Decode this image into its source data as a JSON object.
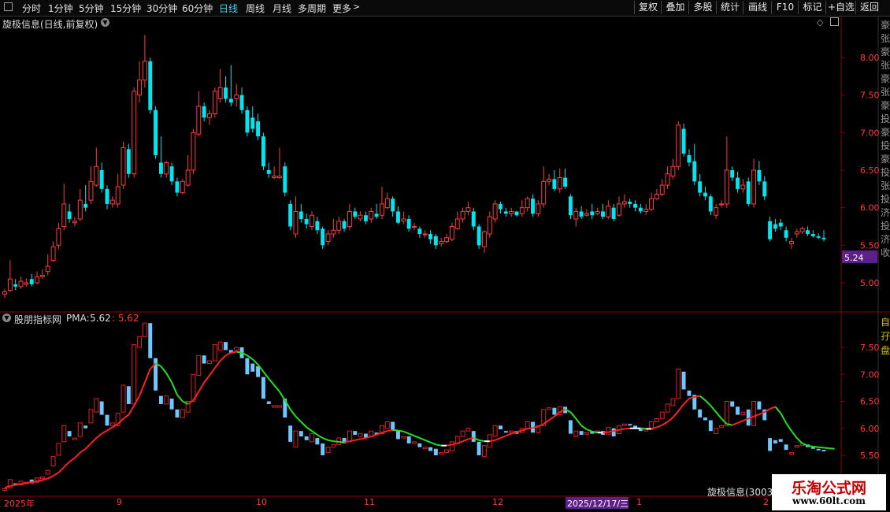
{
  "toolbar": {
    "items": [
      "分时",
      "1分钟",
      "5分钟",
      "15分钟",
      "30分钟",
      "60分钟",
      "日线",
      "周线",
      "月线",
      "多周期",
      "更多"
    ],
    "active": "日线",
    "right_buttons": [
      "复权",
      "叠加",
      "多股",
      "统计",
      "画线",
      "F10",
      "标记",
      "+自选",
      "返回"
    ]
  },
  "main_panel": {
    "title": "旋极信息(日线,前复权)",
    "price_axis": [
      "8.00",
      "7.50",
      "7.00",
      "6.50",
      "6.00",
      "5.50",
      "5.00"
    ],
    "current_price": "5.24",
    "right_strip_chars": "豪张豪张豪张豪投豪投豪投张投济投济收"
  },
  "indicator_panel": {
    "name": "股朋指标网",
    "pma_label": "PMA:",
    "pma_value": "5.62",
    "pma_value2": ": 5.62",
    "axis": [
      "7.50",
      "7.00",
      "6.50",
      "6.00",
      "5.50"
    ],
    "right_strip_chars": "自 孖 盘"
  },
  "time_axis": {
    "labels": [
      "2025年",
      "9",
      "10",
      "11",
      "12",
      "2025/12/17/三",
      "1",
      "2"
    ],
    "bottom_stock": "旋极信息(3003"
  },
  "watermark": {
    "title": "乐淘公式网",
    "url": "www.60lt.com"
  },
  "colors": {
    "up": "#ff3c3c",
    "down": "#00e5ee",
    "grid": "#7a0000",
    "accent": "#35d6f0",
    "highlight": "#5c1f8c",
    "ma_up": "#ff2020",
    "ma_down": "#22e022"
  },
  "chart_data": {
    "type": "candlestick",
    "symbol": "旋极信息",
    "ylim": [
      4.75,
      8.3
    ],
    "indicator_ylim": [
      5.35,
      7.95
    ],
    "candles": [
      [
        4.85,
        4.88,
        4.8,
        4.92
      ],
      [
        4.9,
        5.05,
        4.88,
        5.3
      ],
      [
        4.98,
        4.95,
        4.9,
        5.05
      ],
      [
        4.95,
        5.02,
        4.92,
        5.08
      ],
      [
        4.98,
        5.0,
        4.95,
        5.06
      ],
      [
        5.05,
        4.98,
        4.95,
        5.12
      ],
      [
        5.0,
        5.08,
        4.98,
        5.15
      ],
      [
        5.08,
        5.1,
        5.05,
        5.18
      ],
      [
        5.15,
        5.22,
        5.1,
        5.38
      ],
      [
        5.3,
        5.48,
        5.28,
        5.55
      ],
      [
        5.5,
        5.72,
        5.45,
        5.8
      ],
      [
        5.75,
        6.05,
        5.7,
        6.32
      ],
      [
        5.95,
        5.85,
        5.8,
        6.05
      ],
      [
        5.8,
        5.82,
        5.75,
        5.88
      ],
      [
        5.85,
        6.1,
        5.82,
        6.25
      ],
      [
        6.05,
        6.0,
        5.95,
        6.3
      ],
      [
        6.1,
        6.35,
        6.05,
        6.55
      ],
      [
        6.3,
        6.55,
        6.28,
        6.8
      ],
      [
        6.5,
        6.25,
        6.2,
        6.6
      ],
      [
        6.25,
        6.05,
        5.98,
        6.3
      ],
      [
        6.05,
        6.1,
        6.0,
        6.15
      ],
      [
        6.05,
        6.28,
        6.0,
        6.45
      ],
      [
        6.3,
        6.8,
        6.25,
        6.88
      ],
      [
        6.78,
        6.45,
        6.4,
        6.85
      ],
      [
        6.45,
        7.55,
        6.4,
        7.6
      ],
      [
        7.5,
        7.7,
        7.4,
        7.95
      ],
      [
        7.7,
        7.95,
        7.6,
        8.3
      ],
      [
        7.95,
        7.3,
        7.25,
        8.0
      ],
      [
        7.3,
        6.7,
        6.65,
        7.35
      ],
      [
        6.6,
        6.45,
        6.4,
        6.95
      ],
      [
        6.45,
        6.6,
        6.4,
        6.62
      ],
      [
        6.55,
        6.35,
        6.3,
        6.6
      ],
      [
        6.35,
        6.2,
        6.15,
        6.4
      ],
      [
        6.2,
        6.35,
        6.18,
        6.38
      ],
      [
        6.3,
        6.5,
        6.28,
        6.7
      ],
      [
        6.5,
        7.0,
        6.45,
        7.05
      ],
      [
        6.98,
        7.35,
        6.95,
        7.55
      ],
      [
        7.35,
        7.2,
        7.15,
        7.4
      ],
      [
        7.2,
        7.25,
        7.1,
        7.3
      ],
      [
        7.25,
        7.55,
        7.2,
        7.6
      ],
      [
        7.45,
        7.6,
        7.4,
        7.85
      ],
      [
        7.6,
        7.45,
        7.4,
        7.75
      ],
      [
        7.45,
        7.4,
        7.35,
        7.9
      ],
      [
        7.45,
        7.5,
        7.35,
        7.65
      ],
      [
        7.5,
        7.3,
        7.25,
        7.6
      ],
      [
        7.3,
        7.0,
        6.95,
        7.35
      ],
      [
        7.2,
        7.05,
        7.0,
        7.35
      ],
      [
        7.15,
        6.95,
        6.9,
        7.25
      ],
      [
        6.95,
        6.55,
        6.5,
        7.0
      ],
      [
        6.5,
        6.45,
        6.4,
        6.6
      ],
      [
        6.4,
        6.42,
        6.38,
        6.55
      ],
      [
        6.4,
        6.42,
        6.38,
        6.8
      ],
      [
        6.55,
        6.2,
        6.15,
        6.6
      ],
      [
        6.05,
        5.75,
        5.7,
        6.1
      ],
      [
        5.65,
        5.95,
        5.6,
        6.15
      ],
      [
        5.95,
        5.85,
        5.8,
        6.05
      ],
      [
        5.85,
        5.78,
        5.72,
        5.92
      ],
      [
        5.75,
        5.9,
        5.7,
        5.95
      ],
      [
        5.82,
        5.7,
        5.65,
        5.88
      ],
      [
        5.72,
        5.5,
        5.45,
        5.75
      ],
      [
        5.55,
        5.65,
        5.5,
        5.7
      ],
      [
        5.65,
        5.7,
        5.6,
        5.85
      ],
      [
        5.7,
        5.82,
        5.65,
        5.88
      ],
      [
        5.82,
        5.72,
        5.68,
        5.85
      ],
      [
        5.75,
        5.95,
        5.7,
        6.05
      ],
      [
        5.95,
        5.88,
        5.85,
        6.0
      ],
      [
        5.85,
        5.9,
        5.82,
        5.95
      ],
      [
        5.9,
        5.82,
        5.78,
        5.95
      ],
      [
        5.85,
        5.95,
        5.8,
        6.0
      ],
      [
        5.92,
        5.88,
        5.85,
        6.05
      ],
      [
        5.9,
        6.05,
        5.85,
        6.28
      ],
      [
        6.0,
        6.12,
        5.98,
        6.2
      ],
      [
        6.12,
        5.95,
        5.88,
        6.15
      ],
      [
        5.95,
        5.8,
        5.78,
        6.02
      ],
      [
        5.82,
        5.85,
        5.78,
        5.95
      ],
      [
        5.85,
        5.72,
        5.68,
        5.9
      ],
      [
        5.75,
        5.75,
        5.7,
        5.8
      ],
      [
        5.72,
        5.65,
        5.6,
        5.75
      ],
      [
        5.65,
        5.65,
        5.6,
        5.7
      ],
      [
        5.65,
        5.58,
        5.52,
        5.7
      ],
      [
        5.62,
        5.5,
        5.45,
        5.65
      ],
      [
        5.52,
        5.55,
        5.48,
        5.6
      ],
      [
        5.55,
        5.6,
        5.52,
        5.65
      ],
      [
        5.58,
        5.75,
        5.55,
        5.8
      ],
      [
        5.72,
        5.85,
        5.7,
        5.95
      ],
      [
        5.85,
        5.95,
        5.8,
        6.0
      ],
      [
        5.95,
        6.0,
        5.9,
        6.08
      ],
      [
        5.95,
        5.75,
        5.7,
        6.0
      ],
      [
        5.75,
        5.5,
        5.45,
        5.78
      ],
      [
        5.48,
        5.68,
        5.4,
        5.7
      ],
      [
        5.65,
        5.88,
        5.6,
        5.95
      ],
      [
        5.85,
        6.05,
        5.8,
        6.1
      ],
      [
        6.05,
        5.98,
        5.92,
        6.08
      ],
      [
        5.95,
        5.92,
        5.88,
        6.0
      ],
      [
        5.92,
        5.95,
        5.88,
        6.0
      ],
      [
        5.95,
        5.9,
        5.88,
        5.95
      ],
      [
        5.92,
        6.0,
        5.88,
        6.1
      ],
      [
        6.0,
        6.12,
        5.95,
        6.15
      ],
      [
        6.12,
        5.92,
        5.88,
        6.18
      ],
      [
        5.92,
        6.05,
        5.88,
        6.1
      ],
      [
        6.05,
        6.35,
        6.0,
        6.55
      ],
      [
        6.35,
        6.38,
        6.3,
        6.45
      ],
      [
        6.38,
        6.25,
        6.22,
        6.5
      ],
      [
        6.25,
        6.4,
        6.2,
        6.52
      ],
      [
        6.4,
        6.28,
        6.25,
        6.52
      ],
      [
        6.15,
        5.9,
        5.85,
        6.18
      ],
      [
        5.85,
        5.95,
        5.75,
        6.0
      ],
      [
        5.95,
        5.88,
        5.85,
        6.02
      ],
      [
        5.9,
        5.92,
        5.88,
        5.98
      ],
      [
        5.95,
        5.9,
        5.85,
        6.05
      ],
      [
        5.92,
        5.95,
        5.9,
        6.0
      ],
      [
        5.95,
        5.88,
        5.85,
        6.05
      ],
      [
        5.88,
        6.02,
        5.85,
        6.1
      ],
      [
        6.0,
        5.85,
        5.82,
        6.05
      ],
      [
        5.9,
        6.05,
        5.88,
        6.15
      ],
      [
        6.05,
        6.08,
        6.0,
        6.18
      ],
      [
        6.08,
        6.05,
        6.0,
        6.12
      ],
      [
        6.05,
        6.0,
        5.95,
        6.1
      ],
      [
        6.0,
        5.95,
        5.92,
        6.05
      ],
      [
        5.95,
        5.98,
        5.9,
        6.05
      ],
      [
        5.98,
        6.12,
        5.95,
        6.2
      ],
      [
        6.12,
        6.18,
        6.1,
        6.25
      ],
      [
        6.18,
        6.3,
        6.15,
        6.38
      ],
      [
        6.3,
        6.45,
        6.25,
        6.55
      ],
      [
        6.42,
        6.55,
        6.38,
        6.65
      ],
      [
        6.55,
        7.1,
        6.5,
        7.15
      ],
      [
        7.05,
        6.72,
        6.68,
        7.12
      ],
      [
        6.7,
        6.6,
        6.55,
        6.78
      ],
      [
        6.62,
        6.35,
        6.3,
        6.85
      ],
      [
        6.35,
        6.2,
        6.15,
        6.45
      ],
      [
        6.2,
        6.15,
        6.1,
        6.28
      ],
      [
        6.15,
        5.95,
        5.9,
        6.18
      ],
      [
        5.9,
        6.0,
        5.85,
        6.05
      ],
      [
        6.05,
        6.05,
        6.0,
        6.1
      ],
      [
        6.05,
        6.5,
        6.0,
        6.95
      ],
      [
        6.5,
        6.4,
        6.35,
        6.55
      ],
      [
        6.4,
        6.25,
        6.2,
        6.48
      ],
      [
        6.25,
        6.3,
        6.2,
        6.38
      ],
      [
        6.35,
        6.05,
        6.02,
        6.4
      ],
      [
        6.05,
        6.5,
        6.0,
        6.65
      ],
      [
        6.5,
        6.35,
        6.3,
        6.62
      ],
      [
        6.35,
        6.15,
        6.1,
        6.42
      ],
      [
        5.82,
        5.58,
        5.55,
        5.88
      ],
      [
        5.78,
        5.72,
        5.68,
        5.85
      ],
      [
        5.8,
        5.75,
        5.7,
        5.85
      ],
      [
        5.7,
        5.6,
        5.55,
        5.75
      ],
      [
        5.52,
        5.55,
        5.45,
        5.6
      ],
      [
        5.65,
        5.68,
        5.6,
        5.72
      ],
      [
        5.68,
        5.72,
        5.65,
        5.75
      ],
      [
        5.7,
        5.65,
        5.62,
        5.75
      ],
      [
        5.65,
        5.62,
        5.6,
        5.7
      ],
      [
        5.62,
        5.6,
        5.58,
        5.66
      ],
      [
        5.6,
        5.58,
        5.55,
        5.7
      ]
    ],
    "pma": [
      4.9,
      4.93,
      4.95,
      4.97,
      4.99,
      5.0,
      5.02,
      5.04,
      5.07,
      5.12,
      5.18,
      5.28,
      5.38,
      5.45,
      5.55,
      5.62,
      5.72,
      5.82,
      5.9,
      5.96,
      6.02,
      6.08,
      6.18,
      6.25,
      6.42,
      6.6,
      6.85,
      7.1,
      7.2,
      7.15,
      7.02,
      6.85,
      6.62,
      6.5,
      6.45,
      6.52,
      6.68,
      6.85,
      6.98,
      7.12,
      7.25,
      7.35,
      7.4,
      7.42,
      7.4,
      7.35,
      7.28,
      7.18,
      7.05,
      6.92,
      6.8,
      6.68,
      6.52,
      6.35,
      6.22,
      6.12,
      6.02,
      5.95,
      5.88,
      5.82,
      5.78,
      5.76,
      5.75,
      5.74,
      5.76,
      5.78,
      5.8,
      5.82,
      5.85,
      5.88,
      5.92,
      5.95,
      5.97,
      5.96,
      5.94,
      5.9,
      5.86,
      5.82,
      5.78,
      5.74,
      5.7,
      5.68,
      5.68,
      5.7,
      5.72,
      5.76,
      5.8,
      5.82,
      5.78,
      5.76,
      5.76,
      5.78,
      5.82,
      5.86,
      5.9,
      5.93,
      5.96,
      5.99,
      6.01,
      6.03,
      6.08,
      6.15,
      6.22,
      6.3,
      6.35,
      6.3,
      6.18,
      6.05,
      5.98,
      5.94,
      5.92,
      5.92,
      5.93,
      5.95,
      5.97,
      5.99,
      6.0,
      6.0,
      6.0,
      5.99,
      5.99,
      6.02,
      6.06,
      6.12,
      6.2,
      6.32,
      6.45,
      6.55,
      6.58,
      6.6,
      6.52,
      6.42,
      6.3,
      6.18,
      6.08,
      6.06,
      6.1,
      6.14,
      6.18,
      6.22,
      6.26,
      6.3,
      6.36,
      6.4,
      6.28,
      6.1,
      5.95,
      5.82,
      5.72,
      5.68,
      5.66,
      5.65,
      5.64,
      5.63,
      5.62
    ]
  }
}
